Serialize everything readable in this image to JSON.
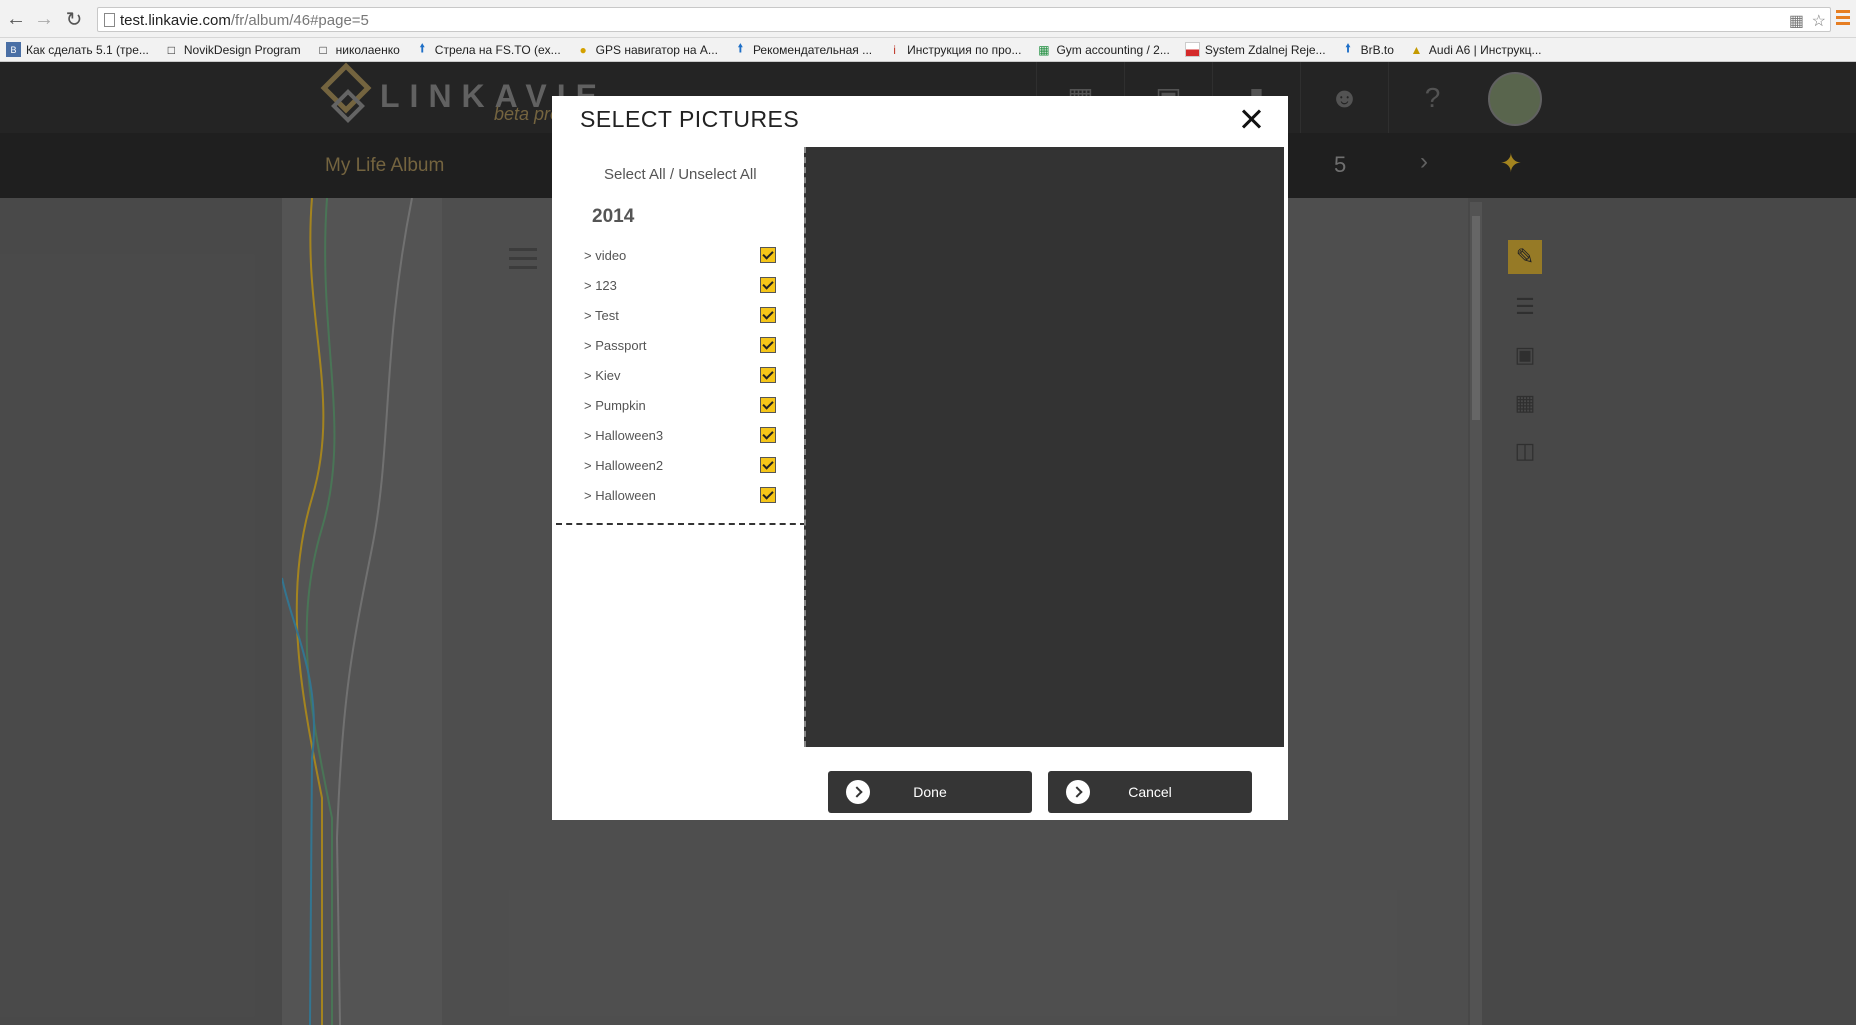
{
  "browser": {
    "url_host": "test.linkavie.com",
    "url_path": "/fr/album/46#page=5",
    "bookmarks": [
      {
        "label": "Как сделать 5.1 (тре...",
        "icon": "vk-icon"
      },
      {
        "label": "NovikDesign Program",
        "icon": "page-icon"
      },
      {
        "label": "николаенко",
        "icon": "page-icon"
      },
      {
        "label": "Стрела на FS.TO (ex...",
        "icon": "arrow-up-icon"
      },
      {
        "label": "GPS навигатор на A...",
        "icon": "gps-icon"
      },
      {
        "label": "Рекомендательная ...",
        "icon": "arrow-up-icon"
      },
      {
        "label": "Инструкция по про...",
        "icon": "info-icon"
      },
      {
        "label": "Gym accounting / 2...",
        "icon": "sheet-icon"
      },
      {
        "label": "System Zdalnej Reje...",
        "icon": "flag-icon"
      },
      {
        "label": "BrB.to",
        "icon": "arrow-up-icon"
      },
      {
        "label": "Audi A6 | Инструкц...",
        "icon": "car-icon"
      }
    ]
  },
  "app": {
    "logo_text": "LINKAVIE",
    "logo_subtext": "beta pro",
    "album_title": "My Life Album",
    "page_number": "5",
    "help_label": "?"
  },
  "modal": {
    "title": "SELECT PICTURES",
    "select_all": "Select All",
    "separator": " / ",
    "unselect_all": "Unselect All",
    "year": "2014",
    "albums": [
      {
        "label": "> video",
        "checked": true
      },
      {
        "label": "> 123",
        "checked": true
      },
      {
        "label": "> Test",
        "checked": true
      },
      {
        "label": "> Passport",
        "checked": true
      },
      {
        "label": "> Kiev",
        "checked": true
      },
      {
        "label": "> Pumpkin",
        "checked": true
      },
      {
        "label": "> Halloween3",
        "checked": true
      },
      {
        "label": "> Halloween2",
        "checked": true
      },
      {
        "label": "> Halloween",
        "checked": true
      }
    ],
    "done_label": "Done",
    "cancel_label": "Cancel"
  },
  "colors": {
    "accent": "#f5c518",
    "brand_gold": "#8e7a4e",
    "button_bg": "#353535"
  }
}
